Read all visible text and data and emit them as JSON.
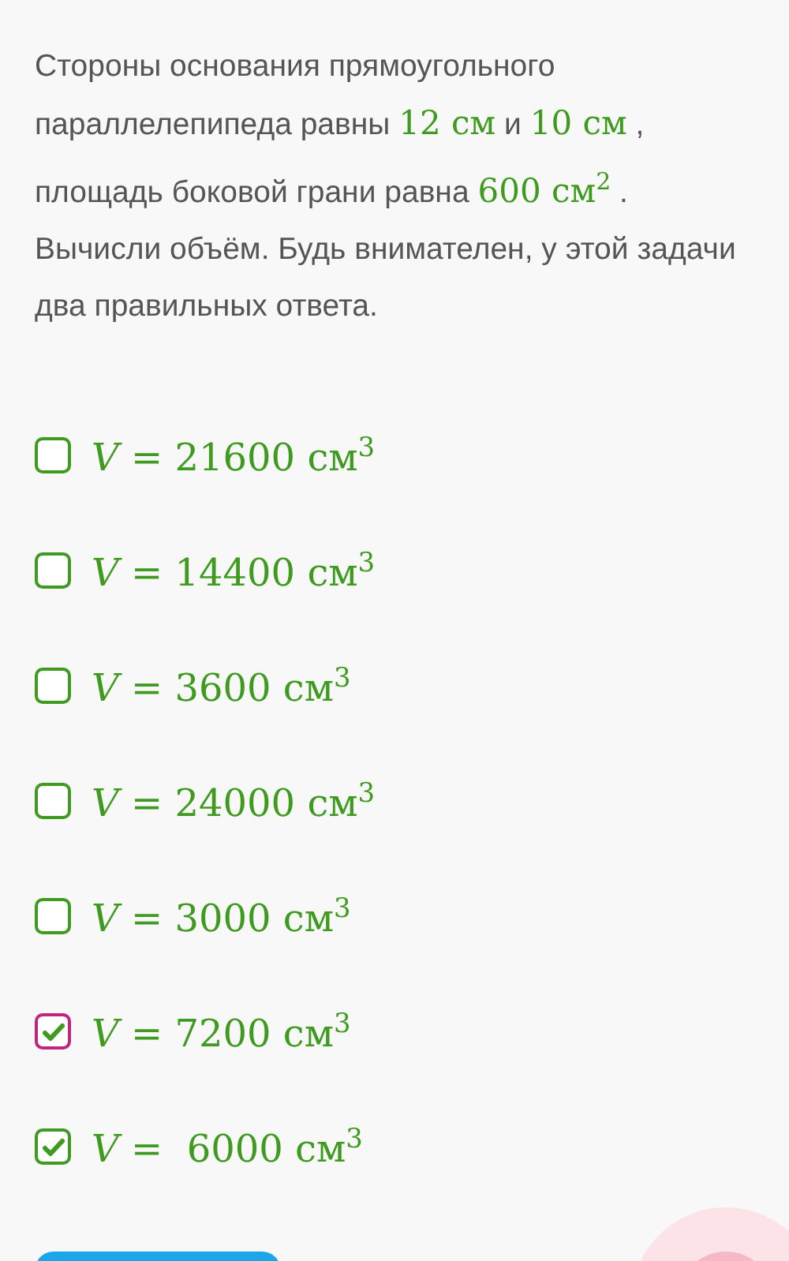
{
  "question": [
    {
      "kind": "text",
      "text": "Стороны основания прямоугольного параллелепипеда равны "
    },
    {
      "kind": "math",
      "text": "12 см"
    },
    {
      "kind": "text",
      "text": " и "
    },
    {
      "kind": "math",
      "text": "10 см"
    },
    {
      "kind": "text",
      "text": " , площадь боковой  грани равна "
    },
    {
      "kind": "math",
      "text": "600 см$^{2}$"
    },
    {
      "kind": "text",
      "text": " . Вычисли объём. Будь внимателен, у этой задачи два правильных ответа."
    }
  ],
  "options": [
    {
      "text": "*V* = 21600 см$^{3}$",
      "checked": false,
      "color": "#3f9b20"
    },
    {
      "text": "*V* = 14400 см$^{3}$",
      "checked": false,
      "color": "#3f9b20"
    },
    {
      "text": "*V* = 3600 см$^{3}$",
      "checked": false,
      "color": "#3f9b20"
    },
    {
      "text": "*V* = 24000 см$^{3}$",
      "checked": false,
      "color": "#3f9b20"
    },
    {
      "text": "*V* = 3000 см$^{3}$",
      "checked": false,
      "color": "#3f9b20"
    },
    {
      "text": "*V* = 7200 см$^{3}$",
      "checked": true,
      "color": "#c0267f"
    },
    {
      "text": "*V* =  6000 см$^{3}$",
      "checked": true,
      "color": "#3f9b20"
    }
  ]
}
